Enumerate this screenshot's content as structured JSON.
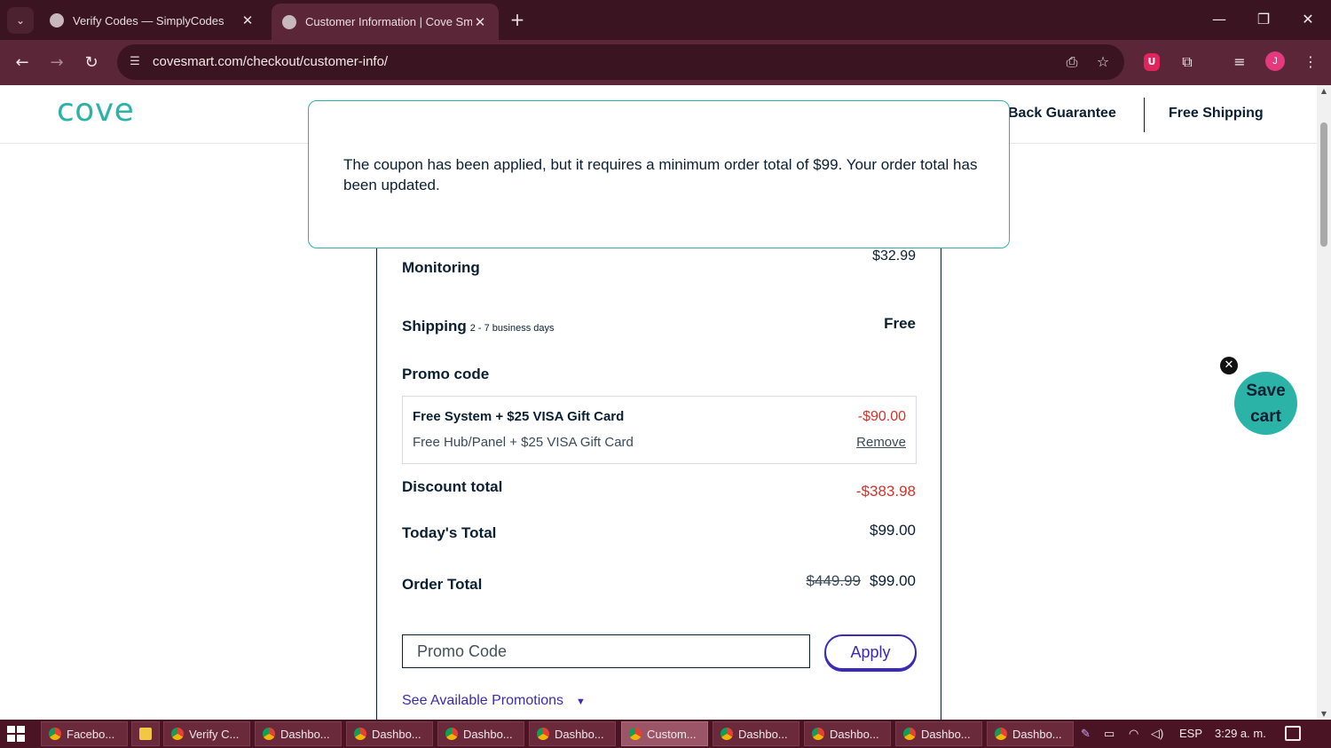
{
  "browser": {
    "tabs": [
      {
        "title": "Verify Codes — SimplyCodes"
      },
      {
        "title": "Customer Information | Cove Smart"
      }
    ],
    "url": "covesmart.com/checkout/customer-info/",
    "profile_initial": "J",
    "extension_badge": "U"
  },
  "site": {
    "logo": "cove",
    "header_links": [
      "Back Guarantee",
      "Free Shipping"
    ]
  },
  "toast": {
    "message": "The coupon has been applied, but it requires a minimum order total of $99. Your order total has been updated."
  },
  "summary": {
    "monitoring": {
      "label": "Monitoring",
      "value": "$32.99"
    },
    "shipping": {
      "label": "Shipping",
      "note": "2 - 7 business days",
      "value": "Free"
    },
    "promo_heading": "Promo code",
    "promo": {
      "title": "Free System + $25 VISA Gift Card",
      "subtitle": "Free Hub/Panel + $25 VISA Gift Card",
      "amount": "-$90.00",
      "remove_label": "Remove"
    },
    "discount_total": {
      "label": "Discount total",
      "value": "-$383.98"
    },
    "todays_total": {
      "label": "Today's Total",
      "value": "$99.00"
    },
    "order_total": {
      "label": "Order Total",
      "original": "$449.99",
      "value": "$99.00"
    },
    "promo_input_placeholder": "Promo Code",
    "apply_label": "Apply",
    "see_promotions_label": "See Available Promotions"
  },
  "save_cart": {
    "label_line1": "Save",
    "label_line2": "cart"
  },
  "taskbar": {
    "items": [
      {
        "label": "Facebo..."
      },
      {
        "label": ""
      },
      {
        "label": "Verify C..."
      },
      {
        "label": "Dashbo..."
      },
      {
        "label": "Dashbo..."
      },
      {
        "label": "Dashbo..."
      },
      {
        "label": "Dashbo..."
      },
      {
        "label": "Custom..."
      },
      {
        "label": "Dashbo..."
      },
      {
        "label": "Dashbo..."
      },
      {
        "label": "Dashbo..."
      },
      {
        "label": "Dashbo..."
      }
    ],
    "language": "ESP",
    "clock": "3:29 a. m."
  },
  "colors": {
    "brand_teal": "#2bb3a8",
    "accent_purple": "#3b2bb5",
    "discount_red": "#d2342c",
    "chrome_bg": "#3a1420"
  }
}
